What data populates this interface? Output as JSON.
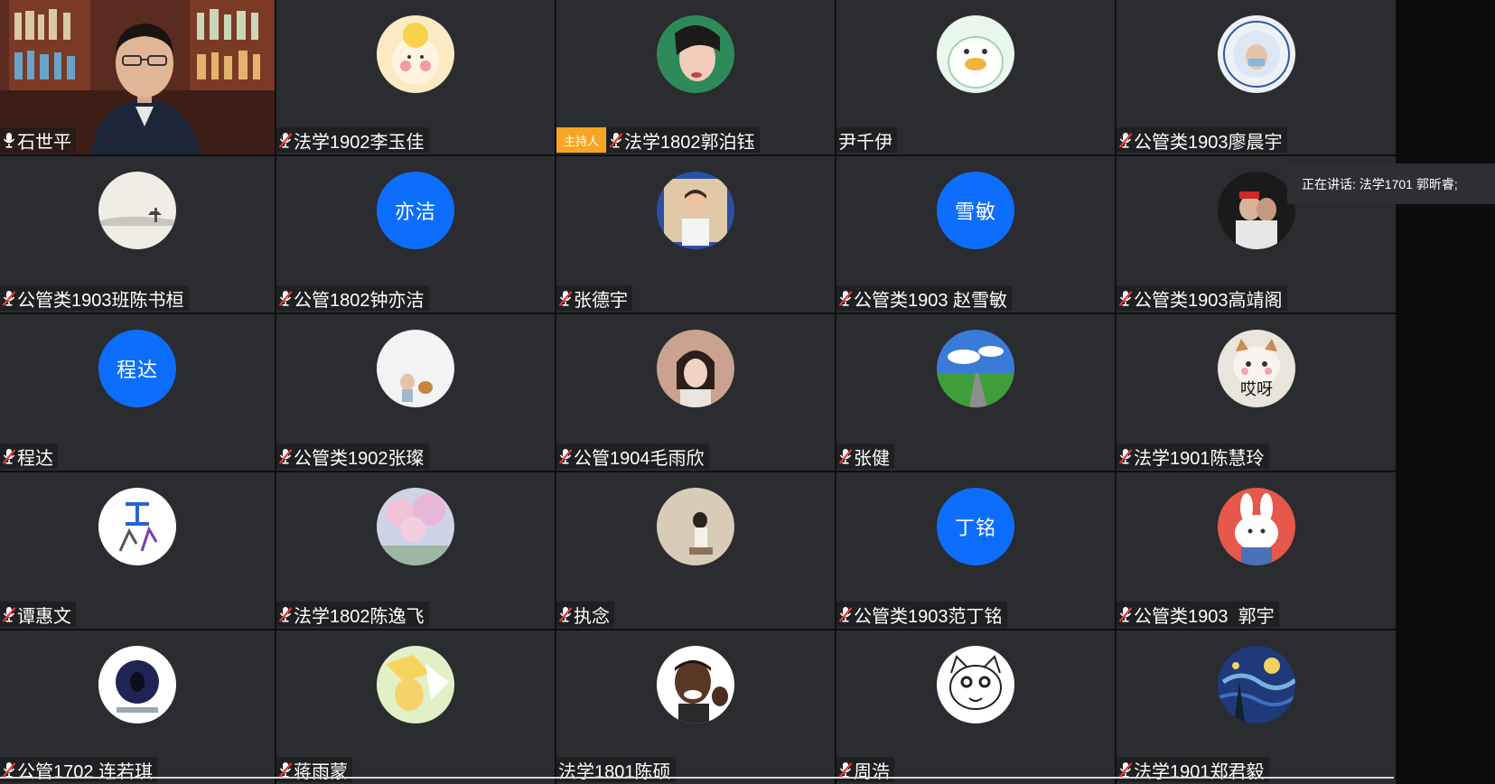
{
  "participants": [
    {
      "name": "石世平",
      "self": true,
      "mic": "on",
      "avatar": "video-feed"
    },
    {
      "name": "法学1902李玉佳",
      "mic": "muted",
      "avatar": "cartoon-girl-photo"
    },
    {
      "name": "法学1802郭泊钰",
      "mic": "muted",
      "host": true,
      "avatar": "girl-portrait-photo"
    },
    {
      "name": "尹千伊",
      "mic": "none",
      "avatar": "cartoon-duck-photo"
    },
    {
      "name": "公管类1903廖晨宇",
      "mic": "muted",
      "avatar": "university-badge-photo"
    },
    {
      "name": "公管类1903班陈书桓",
      "mic": "muted",
      "avatar": "ink-landscape-photo"
    },
    {
      "name": "公管1802钟亦洁",
      "mic": "muted",
      "avatar_text": "亦洁"
    },
    {
      "name": "张德宇",
      "mic": "muted",
      "avatar": "young-man-photo"
    },
    {
      "name": "公管类1903 赵雪敏",
      "mic": "muted",
      "avatar_text": "雪敏"
    },
    {
      "name": "公管类1903高靖阁",
      "mic": "muted",
      "avatar": "couple-photo"
    },
    {
      "name": "程达",
      "mic": "muted",
      "avatar_text": "程达"
    },
    {
      "name": "公管类1902张璨",
      "mic": "muted",
      "avatar": "child-and-dog-photo"
    },
    {
      "name": "公管1904毛雨欣",
      "mic": "muted",
      "avatar": "girl-bob-hair-photo"
    },
    {
      "name": "张健",
      "mic": "muted",
      "avatar": "road-sky-photo"
    },
    {
      "name": "法学1901陈慧玲",
      "mic": "muted",
      "avatar": "cat-meme-photo",
      "avatar_caption": "哎呀"
    },
    {
      "name": "谭惠文",
      "mic": "muted",
      "avatar": "dance-logo-photo"
    },
    {
      "name": "法学1802陈逸飞",
      "mic": "muted",
      "avatar": "cherry-blossom-photo"
    },
    {
      "name": "执念",
      "mic": "muted",
      "avatar": "girl-sitting-photo"
    },
    {
      "name": "公管类1903范丁铭",
      "mic": "muted",
      "avatar_text": "丁铭"
    },
    {
      "name": "公管类1903  郭宇",
      "mic": "muted",
      "avatar": "bunny-cartoon-photo"
    },
    {
      "name": "公管1702 连若琪",
      "mic": "muted",
      "avatar": "night-portrait-photo"
    },
    {
      "name": "蒋雨蒙",
      "mic": "muted",
      "avatar": "anime-character-photo"
    },
    {
      "name": "法学1801陈硕",
      "mic": "none",
      "avatar": "cartoon-man-photo"
    },
    {
      "name": "周浩",
      "mic": "muted",
      "avatar": "cat-sketch-photo"
    },
    {
      "name": "法学1901郑君毅",
      "mic": "muted",
      "avatar": "starry-night-photo"
    }
  ],
  "host_badge": "主持人",
  "speaking_tooltip": "正在讲话: 法学1701 郭昕睿;",
  "colors": {
    "tile_bg": "#2a2c30",
    "text_avatar_bg": "#0d6efd",
    "host_badge_bg": "#f6a623",
    "muted_slash": "#e53935"
  }
}
